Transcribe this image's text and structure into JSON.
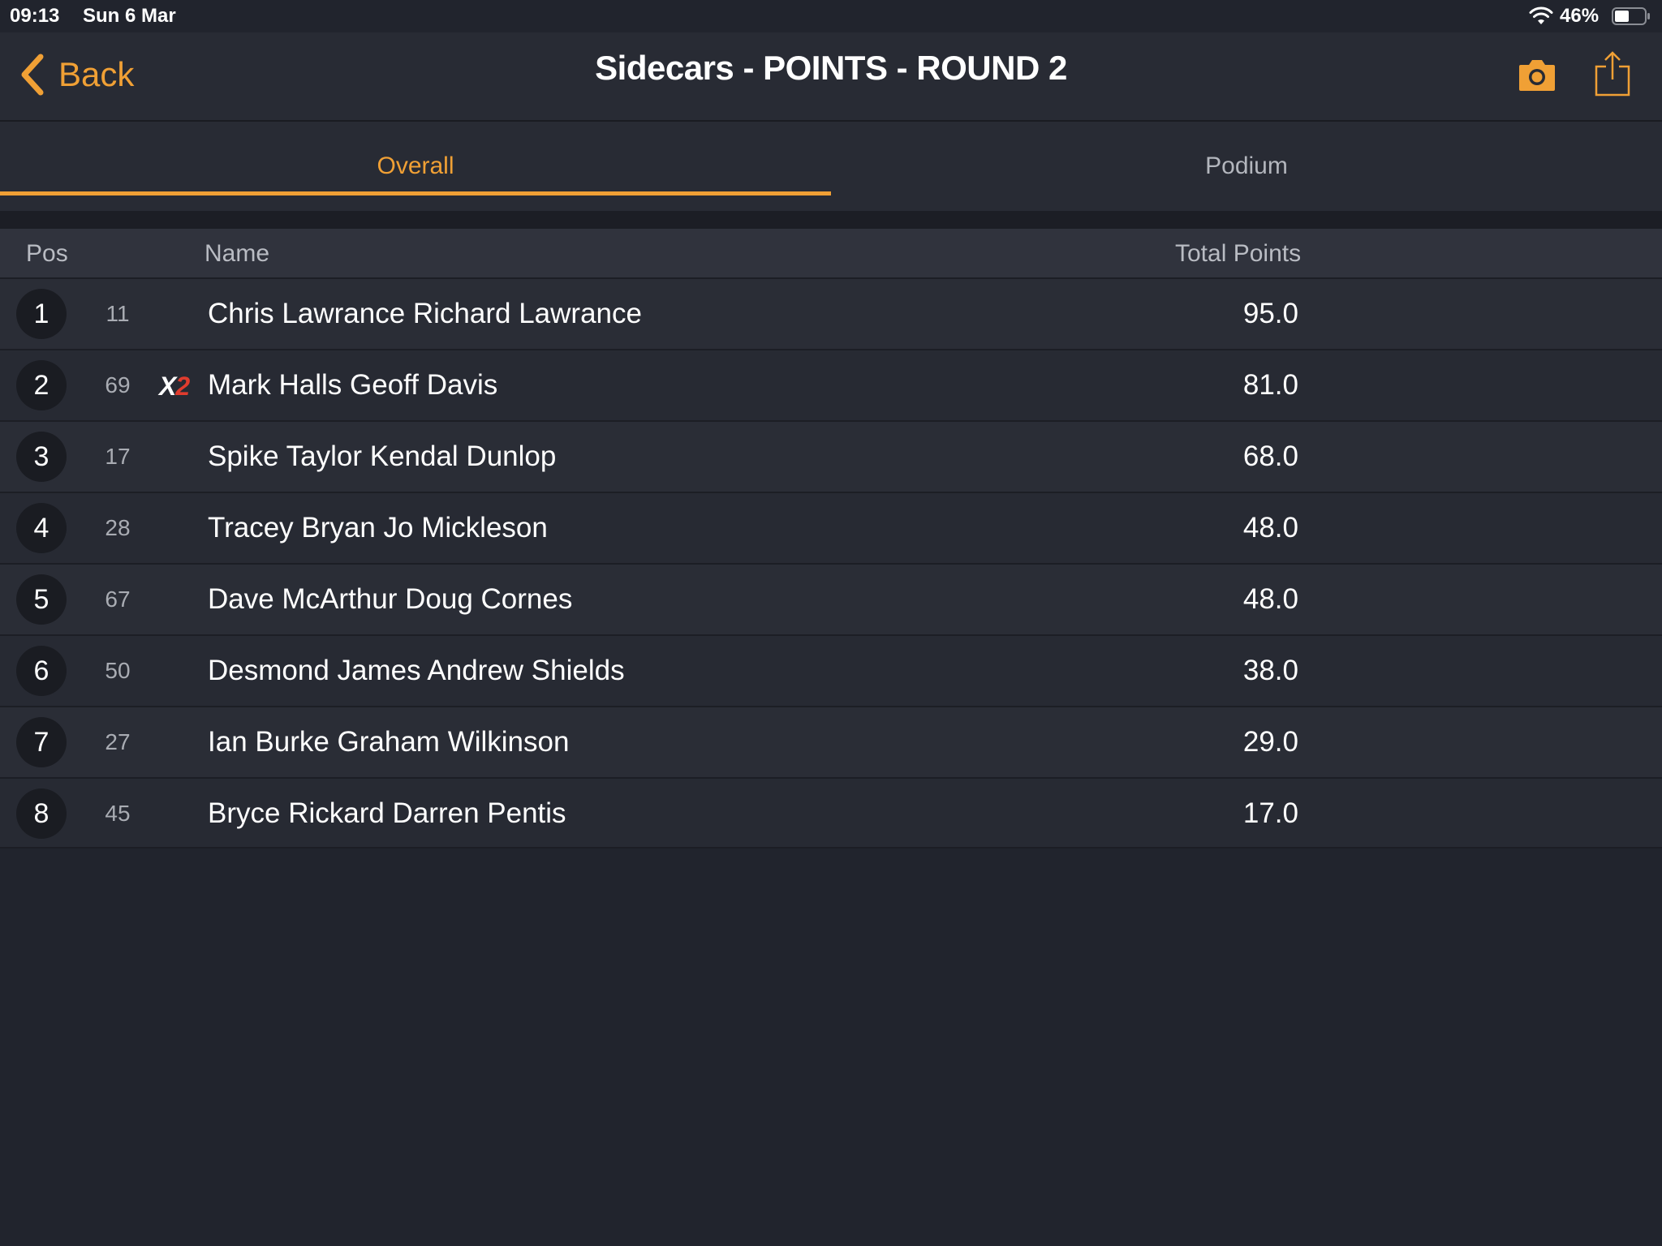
{
  "status_bar": {
    "time": "09:13",
    "date": "Sun 6 Mar",
    "battery": "46%"
  },
  "nav": {
    "back_label": "Back",
    "title": "Sidecars - POINTS - ROUND 2",
    "accent_color": "#f0a035"
  },
  "tabs": [
    {
      "label": "Overall",
      "selected": true
    },
    {
      "label": "Podium",
      "selected": false
    }
  ],
  "table": {
    "headers": {
      "pos": "Pos",
      "name": "Name",
      "points": "Total Points"
    },
    "rows": [
      {
        "pos": "1",
        "number": "11",
        "badge": "",
        "name": "Chris Lawrance Richard Lawrance",
        "points": "95.0"
      },
      {
        "pos": "2",
        "number": "69",
        "badge": "X2",
        "name": "Mark Halls Geoff Davis",
        "points": "81.0"
      },
      {
        "pos": "3",
        "number": "17",
        "badge": "",
        "name": "Spike Taylor Kendal Dunlop",
        "points": "68.0"
      },
      {
        "pos": "4",
        "number": "28",
        "badge": "",
        "name": "Tracey Bryan Jo Mickleson",
        "points": "48.0"
      },
      {
        "pos": "5",
        "number": "67",
        "badge": "",
        "name": "Dave McArthur Doug Cornes",
        "points": "48.0"
      },
      {
        "pos": "6",
        "number": "50",
        "badge": "",
        "name": "Desmond James Andrew Shields",
        "points": "38.0"
      },
      {
        "pos": "7",
        "number": "27",
        "badge": "",
        "name": "Ian Burke Graham Wilkinson",
        "points": "29.0"
      },
      {
        "pos": "8",
        "number": "45",
        "badge": "",
        "name": "Bryce Rickard Darren Pentis",
        "points": "17.0"
      }
    ]
  },
  "icons": {
    "back": "chevron-left-icon",
    "camera": "camera-icon",
    "share": "share-icon",
    "wifi": "wifi-icon",
    "battery": "battery-icon"
  }
}
